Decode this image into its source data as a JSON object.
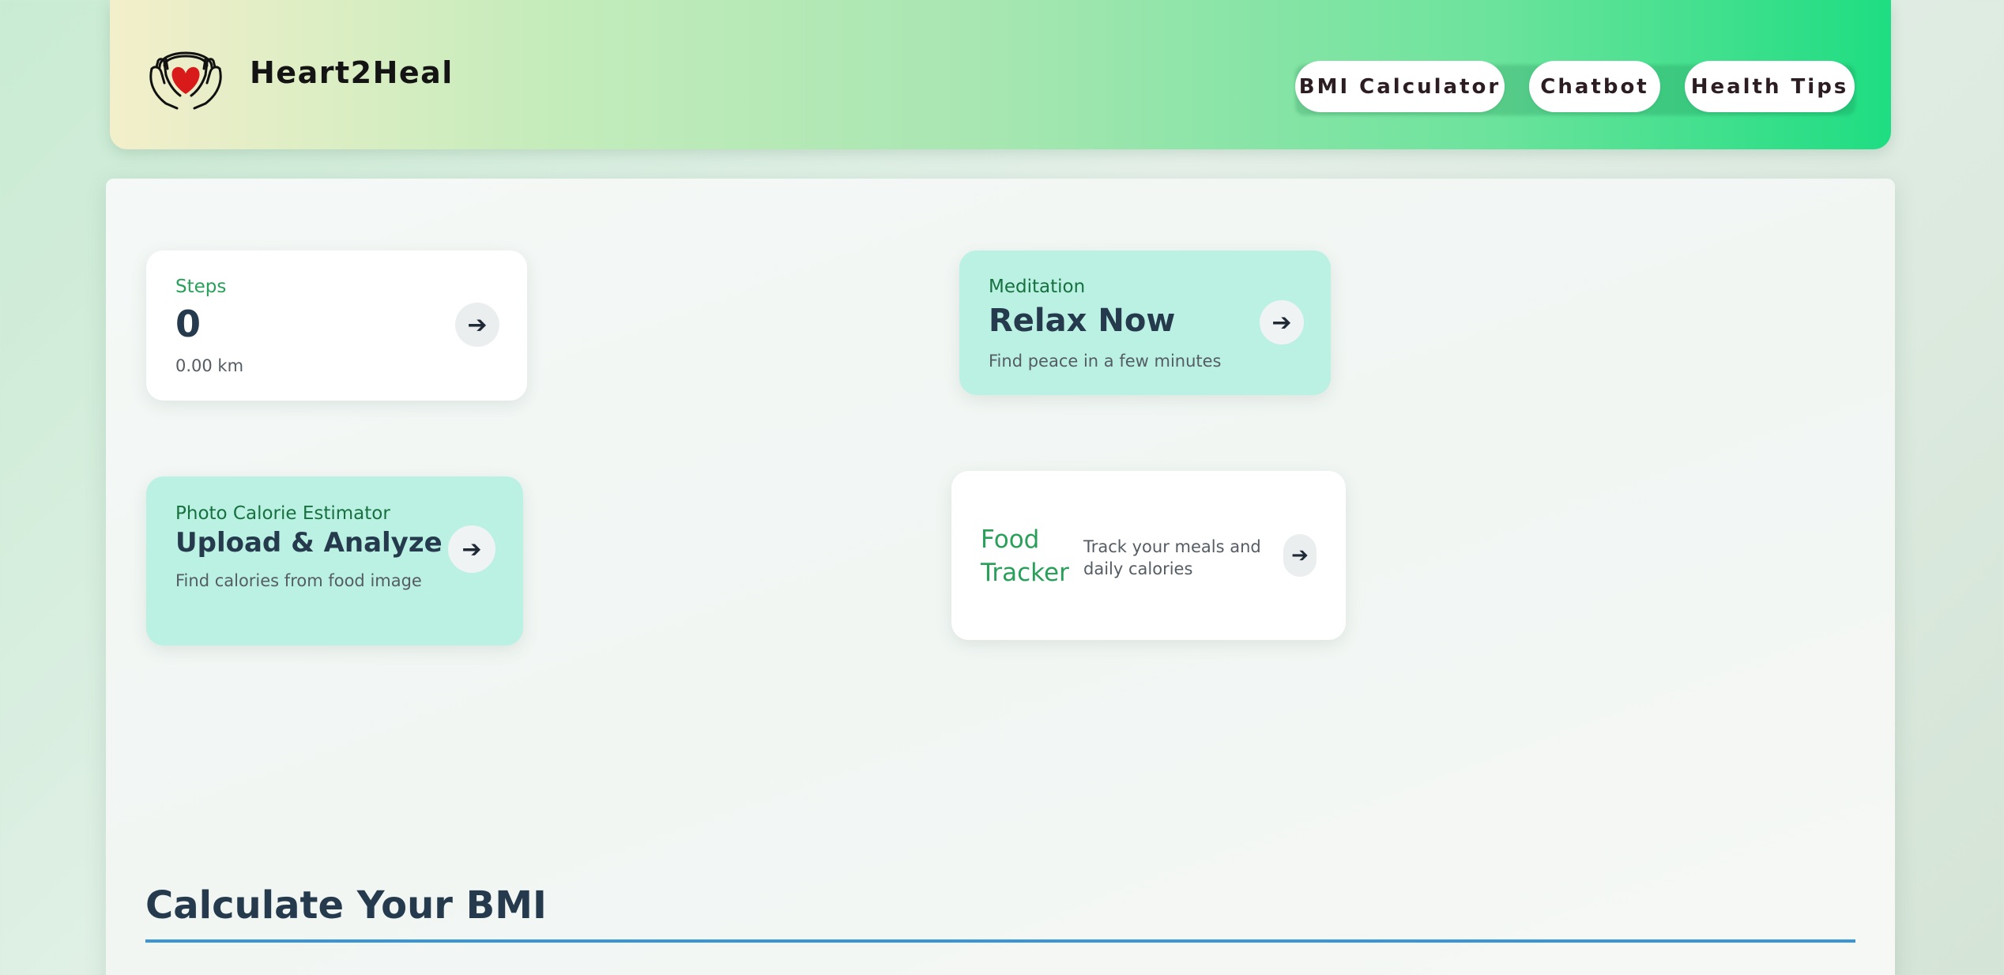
{
  "header": {
    "brand": "Heart2Heal",
    "logo_icon": "heart-in-hands-icon",
    "nav": [
      {
        "label": "BMI Calculator"
      },
      {
        "label": "Chatbot"
      },
      {
        "label": "Health Tips"
      }
    ]
  },
  "cards": {
    "steps": {
      "label": "Steps",
      "value": "0",
      "distance": "0.00 km",
      "arrow": "➔"
    },
    "meditation": {
      "label": "Meditation",
      "title": "Relax Now",
      "subtitle": "Find peace in a few minutes",
      "arrow": "➔"
    },
    "photo_calorie": {
      "label": "Photo Calorie Estimator",
      "title": "Upload & Analyze",
      "subtitle": "Find calories from food image",
      "arrow": "➔"
    },
    "food_tracker": {
      "title": "Food Tracker",
      "subtitle": "Track your meals and daily calories",
      "arrow": "➔"
    }
  },
  "bmi_section": {
    "title": "Calculate Your BMI"
  },
  "colors": {
    "accent_green": "#28a05a",
    "mint_card": "#bbf1e3",
    "heading_navy": "#253a4d",
    "rule_blue": "#3b95d4",
    "heart_red": "#d91a1a"
  }
}
